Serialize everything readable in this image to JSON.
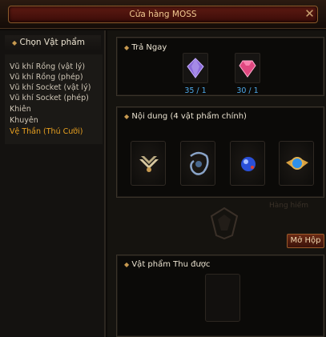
{
  "window": {
    "title": "Cửa hàng MOSS"
  },
  "left_panel": {
    "header": "Chọn Vật phẩm",
    "categories": [
      "Vũ khí Rồng (vật lý)",
      "Vũ khí Rồng (phép)",
      "Vũ khí Socket (vật lý)",
      "Vũ khí Socket (phép)",
      "Khiên",
      "Khuyên",
      "Vệ Thần (Thú Cưỡi)"
    ],
    "selected": "Vệ Thần (Thú Cưỡi)"
  },
  "buy_now": {
    "title": "Trả Ngay",
    "prices": [
      {
        "icon": "purple-gem-icon",
        "label": "35 / 1",
        "color": "#8a6ad8"
      },
      {
        "icon": "pink-gem-icon",
        "label": "30 / 1",
        "color": "#e04880"
      }
    ]
  },
  "contents": {
    "title": "Nội dung (4 vật phẩm chính)",
    "items": [
      "winged-emblem-icon",
      "dark-mark-icon",
      "blue-orb-icon",
      "winged-blue-jewel-icon"
    ]
  },
  "open_button": "Mở Hộp",
  "background_text": "Hàng hiếm",
  "reward": {
    "title": "Vật phẩm Thu được"
  },
  "colors": {
    "accent": "#e8a020",
    "price": "#4ea8e8"
  }
}
